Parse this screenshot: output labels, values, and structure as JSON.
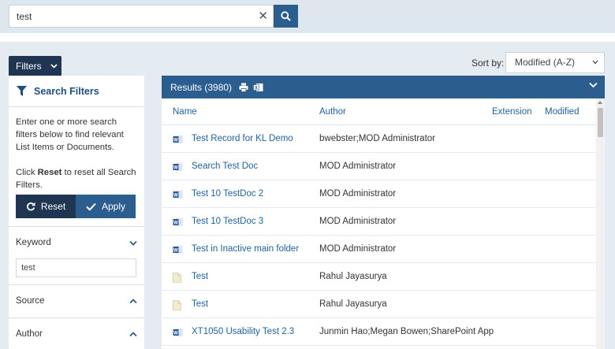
{
  "search": {
    "query": "test",
    "clear_glyph": "✕"
  },
  "toolbar": {
    "filters_label": "Filters",
    "sort_label": "Sort by:",
    "sort_value": "Modified (A-Z)"
  },
  "filters": {
    "title": "Search Filters",
    "help_line1": "Enter one or more search filters below to find relevant List Items or Documents.",
    "help_click": "Click ",
    "help_reset_word": "Reset",
    "help_rest": " to reset all Search Filters.",
    "reset_label": "Reset",
    "apply_label": "Apply",
    "keyword_label": "Keyword",
    "keyword_value": "test",
    "source_label": "Source",
    "author_label": "Author"
  },
  "results": {
    "title": "Results (3980)",
    "columns": {
      "name": "Name",
      "author": "Author",
      "extension": "Extension",
      "modified": "Modified"
    },
    "rows": [
      {
        "title": "Test Record for KL Demo",
        "author": "bwebster;MOD Administrator",
        "icon": "word-icon"
      },
      {
        "title": "Search Test Doc",
        "author": "MOD Administrator",
        "icon": "word-icon"
      },
      {
        "title": "Test 10 TestDoc 2",
        "author": "MOD Administrator",
        "icon": "word-icon"
      },
      {
        "title": "Test 10 TestDoc 3",
        "author": "MOD Administrator",
        "icon": "word-icon"
      },
      {
        "title": "Test in Inactive main folder",
        "author": "MOD Administrator",
        "icon": "word-icon"
      },
      {
        "title": "Test",
        "author": "Rahul Jayasurya",
        "icon": "page-icon"
      },
      {
        "title": "Test",
        "author": "Rahul Jayasurya",
        "icon": "page-icon"
      },
      {
        "title": "XT1050 Usability Test 2.3",
        "author": "Junmin Hao;Megan Bowen;SharePoint App",
        "icon": "word-icon"
      }
    ]
  },
  "colors": {
    "navy": "#1f3552",
    "blue": "#2c5d8f",
    "link": "#1f5f99",
    "background": "#e4ebf1"
  }
}
